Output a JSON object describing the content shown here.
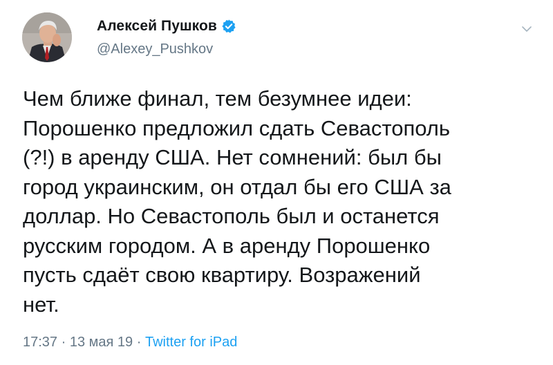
{
  "tweet": {
    "author": {
      "display_name": "Алексей Пушков",
      "handle": "@Alexey_Pushkov",
      "verified": true
    },
    "text": "Чем ближе финал, тем безумнее идеи:\nПорошенко предложил сдать Севастополь\n(?!) в аренду США. Нет сомнений: был бы\nгород украинским, он отдал бы его США за\nдоллар. Но Севастополь был и останется\nрусским городом. А в аренду Порошенко\nпусть сдаёт свою квартиру. Возражений\nнет.",
    "time": "17:37",
    "separator": "·",
    "date": "13 мая 19",
    "source": "Twitter for iPad"
  },
  "colors": {
    "text": "#14171a",
    "secondary": "#657786",
    "accent": "#1da1f2"
  },
  "icons": {
    "verified": "verified-badge-icon",
    "menu": "chevron-down-icon"
  }
}
